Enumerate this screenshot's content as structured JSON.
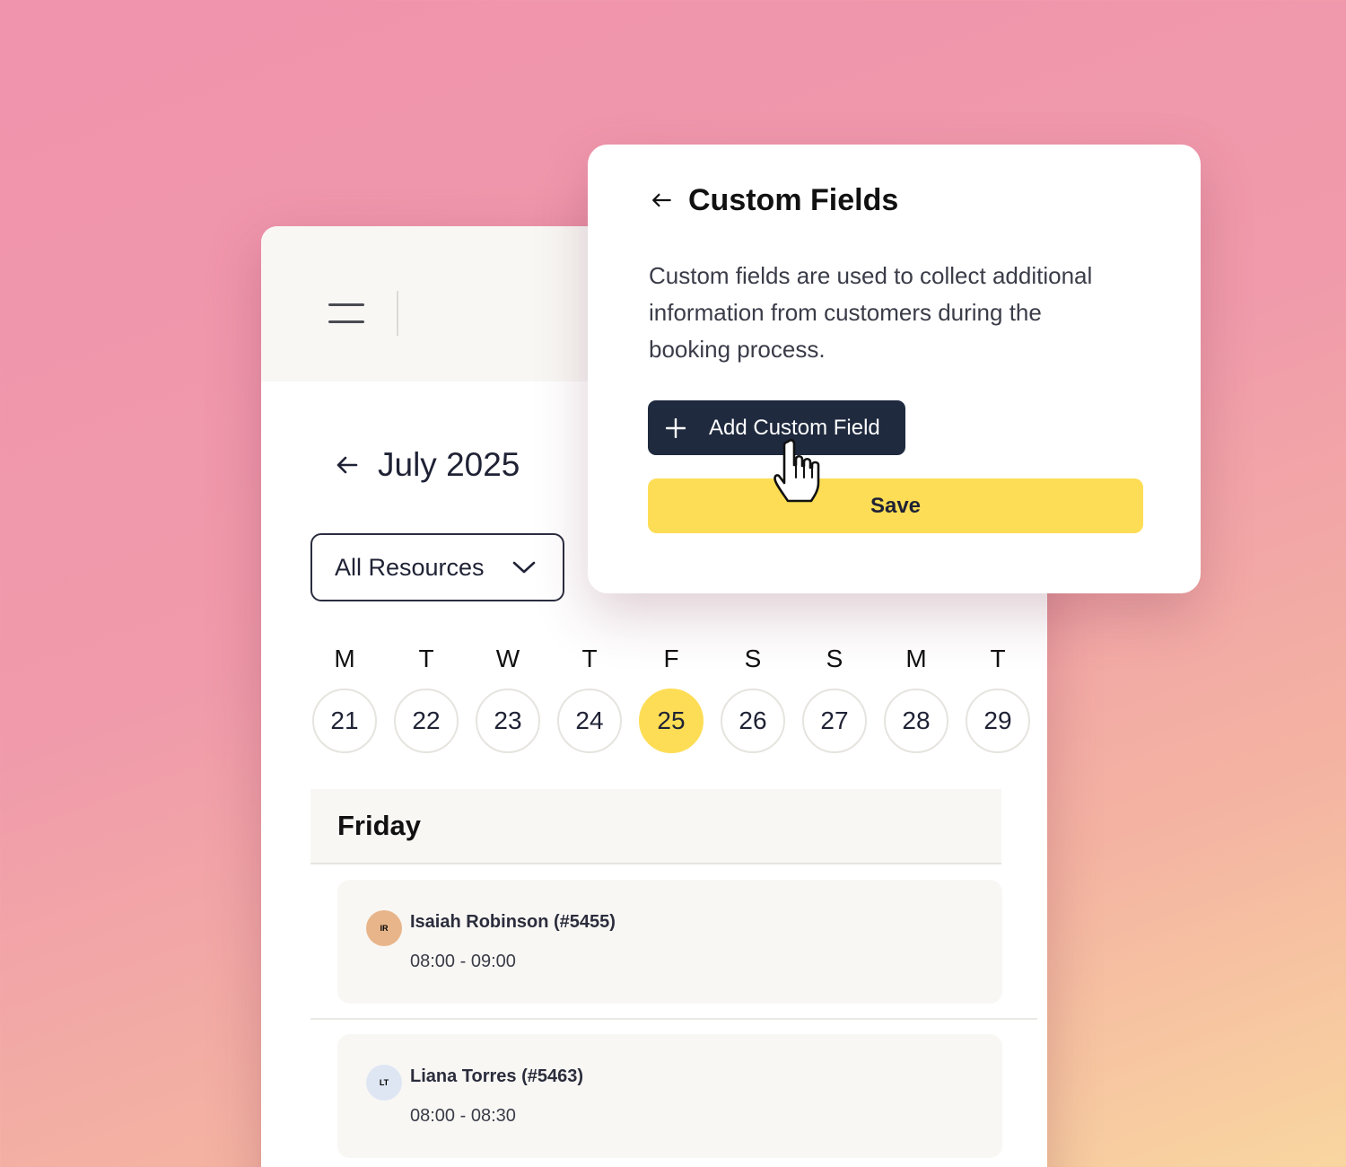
{
  "calendar": {
    "month_title": "July 2025",
    "resources_select": {
      "value": "All Resources"
    },
    "weekdays": [
      "M",
      "T",
      "W",
      "T",
      "F",
      "S",
      "S",
      "M",
      "T"
    ],
    "dates": [
      "21",
      "22",
      "23",
      "24",
      "25",
      "26",
      "27",
      "28",
      "29"
    ],
    "selected_date": "25",
    "day_heading": "Friday",
    "bookings": [
      {
        "initials": "IR",
        "name": "Isaiah Robinson (#5455)",
        "time": "08:00 - 09:00",
        "avatar_color": "#e8b58a"
      },
      {
        "initials": "LT",
        "name": "Liana Torres (#5463)",
        "time": "08:00 - 08:30",
        "avatar_color": "#dfe6f3"
      }
    ]
  },
  "custom_fields": {
    "title": "Custom Fields",
    "description": "Custom fields are used to collect additional information from customers during the booking process.",
    "add_button_label": "Add Custom Field",
    "save_button_label": "Save"
  },
  "colors": {
    "accent_yellow": "#fddd55",
    "dark_button": "#1f2a3f"
  },
  "icons": {
    "menu": "hamburger-icon",
    "back": "arrow-left-icon",
    "dropdown": "chevron-down-icon",
    "add": "plus-icon",
    "pointer": "hand-pointer-cursor"
  }
}
